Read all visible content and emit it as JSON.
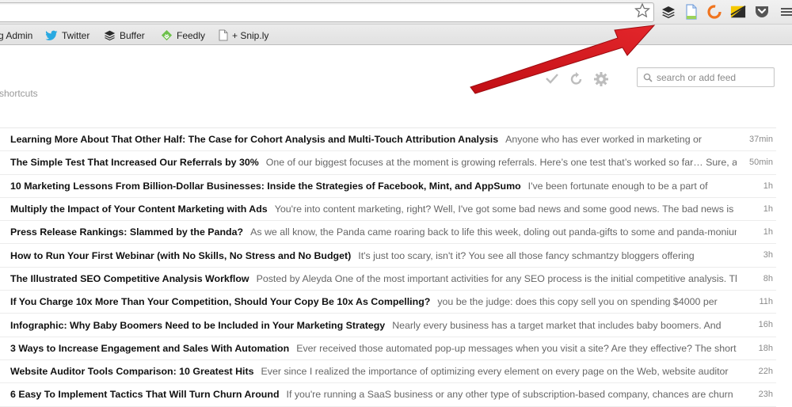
{
  "browser": {
    "extensions": [
      {
        "icon": "buffer-icon",
        "color": "#2b2b2b"
      },
      {
        "icon": "page-icon",
        "color": "#5b8fd6"
      },
      {
        "icon": "ring-icon",
        "color": "#f0741e"
      },
      {
        "icon": "feedly-icon",
        "color": "#f5c800"
      },
      {
        "icon": "pocket-icon",
        "color": "#555555"
      },
      {
        "icon": "menu-icon",
        "color": "#555555"
      }
    ]
  },
  "bookmarks": [
    {
      "label": "g Admin",
      "icon": "admin-icon"
    },
    {
      "label": "Twitter",
      "icon": "twitter-icon",
      "color": "#29a9e1"
    },
    {
      "label": "Buffer",
      "icon": "buffer-icon",
      "color": "#2b2b2b"
    },
    {
      "label": "Feedly",
      "icon": "feedly-icon",
      "color": "#6cc04a"
    },
    {
      "label": "+ Snip.ly",
      "icon": "page-icon"
    }
  ],
  "app": {
    "shortcuts_label": "shortcuts",
    "search_placeholder": "search or add feed",
    "actions": [
      "check-icon",
      "refresh-icon",
      "gear-icon"
    ]
  },
  "articles": [
    {
      "title": "Learning More About That Other Half: The Case for Cohort Analysis and Multi-Touch Attribution Analysis",
      "snippet": "Anyone who has ever worked in marketing or",
      "age": "37min"
    },
    {
      "title": "The Simple Test That Increased Our Referrals by 30%",
      "snippet": "One of our biggest focuses at the moment is growing referrals. Here’s one test that’s worked so far… Sure, a",
      "age": "50min"
    },
    {
      "title": "10 Marketing Lessons From Billion-Dollar Businesses: Inside the Strategies of Facebook, Mint, and AppSumo",
      "snippet": "I've been fortunate enough to be a part of",
      "age": "1h"
    },
    {
      "title": "Multiply the Impact of Your Content Marketing with Ads",
      "snippet": "You're into content marketing, right? Well, I've got some bad news and some good news. The bad news is",
      "age": "1h"
    },
    {
      "title": "Press Release Rankings: Slammed by the Panda?",
      "snippet": "As we all know, the Panda came roaring back to life this week, doling out panda-gifts to some and panda-monium",
      "age": "1h"
    },
    {
      "title": "How to Run Your First Webinar (with No Skills, No Stress and No Budget)",
      "snippet": "It's just too scary, isn't it? You see all those fancy schmantzy bloggers offering",
      "age": "3h"
    },
    {
      "title": "The Illustrated SEO Competitive Analysis Workflow",
      "snippet": "Posted by Aleyda One of the most important activities for any SEO process is the initial competitive analysis. This",
      "age": "8h"
    },
    {
      "title": "If You Charge 10x More Than Your Competition, Should Your Copy Be 10x As Compelling?",
      "snippet": "you be the judge: does this copy sell you on spending $4000 per",
      "age": "11h"
    },
    {
      "title": "Infographic: Why Baby Boomers Need to be Included in Your Marketing Strategy",
      "snippet": "Nearly every business has a target market that includes baby boomers. And",
      "age": "16h"
    },
    {
      "title": "3 Ways to Increase Engagement and Sales With Automation",
      "snippet": "Ever received those automated pop-up messages when you visit a site? Are they effective? The short",
      "age": "18h"
    },
    {
      "title": "Website Auditor Tools Comparison: 10 Greatest Hits",
      "snippet": "Ever since I realized the importance of optimizing every element on every page on the Web, website auditor",
      "age": "22h"
    },
    {
      "title": "6 Easy To Implement Tactics That Will Turn Churn Around",
      "snippet": "If you're running a SaaS business or any other type of subscription-based company, chances are churn",
      "age": "23h"
    }
  ],
  "annotation": {
    "color": "#d9171d"
  }
}
